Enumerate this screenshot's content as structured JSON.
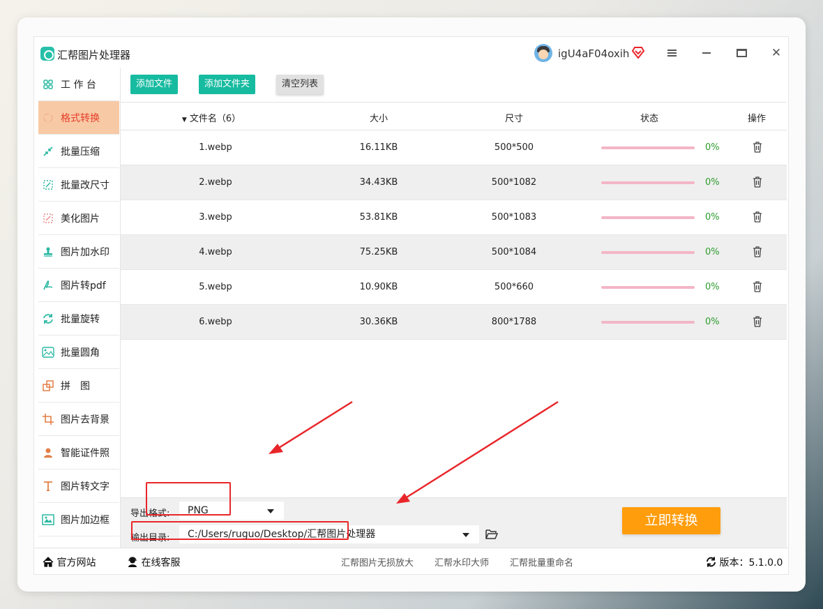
{
  "app": {
    "title": "汇帮图片处理器",
    "username": "igU4aF04oxih"
  },
  "sidebar": {
    "items": [
      {
        "label": "工 作 台",
        "icon": "grid-icon"
      },
      {
        "label": "格式转换",
        "icon": "format-convert-icon",
        "active": true
      },
      {
        "label": "批量压缩",
        "icon": "compress-icon"
      },
      {
        "label": "批量改尺寸",
        "icon": "resize-icon"
      },
      {
        "label": "美化图片",
        "icon": "beautify-icon"
      },
      {
        "label": "图片加水印",
        "icon": "watermark-icon"
      },
      {
        "label": "图片转pdf",
        "icon": "pdf-icon"
      },
      {
        "label": "批量旋转",
        "icon": "rotate-icon"
      },
      {
        "label": "批量圆角",
        "icon": "rounded-corner-icon"
      },
      {
        "label": "拼　图",
        "icon": "puzzle-icon"
      },
      {
        "label": "图片去背景",
        "icon": "crop-icon"
      },
      {
        "label": "智能证件照",
        "icon": "person-icon"
      },
      {
        "label": "图片转文字",
        "icon": "text-icon"
      },
      {
        "label": "图片加边框",
        "icon": "border-icon"
      }
    ]
  },
  "toolbar": {
    "add_file": "添加文件",
    "add_folder": "添加文件夹",
    "clear_list": "清空列表"
  },
  "table": {
    "headers": {
      "filename": "文件名（6）",
      "size": "大小",
      "dimensions": "尺寸",
      "status": "状态",
      "actions": "操作"
    },
    "rows": [
      {
        "name": "1.webp",
        "size": "16.11KB",
        "dim": "500*500",
        "progress": "0%",
        "progress_value": 0
      },
      {
        "name": "2.webp",
        "size": "34.43KB",
        "dim": "500*1082",
        "progress": "0%",
        "progress_value": 0
      },
      {
        "name": "3.webp",
        "size": "53.81KB",
        "dim": "500*1083",
        "progress": "0%",
        "progress_value": 0
      },
      {
        "name": "4.webp",
        "size": "75.25KB",
        "dim": "500*1084",
        "progress": "0%",
        "progress_value": 0
      },
      {
        "name": "5.webp",
        "size": "10.90KB",
        "dim": "500*660",
        "progress": "0%",
        "progress_value": 0
      },
      {
        "name": "6.webp",
        "size": "30.36KB",
        "dim": "800*1788",
        "progress": "0%",
        "progress_value": 0
      }
    ]
  },
  "output": {
    "format_label": "导出格式:",
    "format_value": "PNG",
    "dir_label": "输出目录:",
    "dir_value": "C:/Users/ruguo/Desktop/汇帮图片处理器",
    "convert_button": "立即转换"
  },
  "footer": {
    "website": "官方网站",
    "support": "在线客服",
    "links": [
      "汇帮图片无损放大",
      "汇帮水印大师",
      "汇帮批量重命名"
    ],
    "version_label": "版本：",
    "version": "5.1.0.0"
  },
  "colors": {
    "accent_green": "#17bba0",
    "active_bg": "#f8c9a5",
    "active_text": "#e53e2a",
    "convert_orange": "#ff9d0c",
    "progress_pink": "#f3b6c6",
    "annotation_red": "#e8262a"
  }
}
